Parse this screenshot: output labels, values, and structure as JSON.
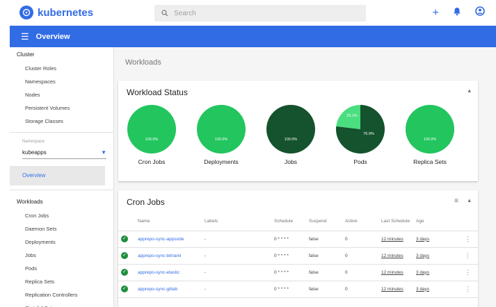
{
  "app": {
    "brand": "kubernetes"
  },
  "search": {
    "placeholder": "Search"
  },
  "header": {
    "title": "Overview"
  },
  "sidebar": {
    "cluster_label": "Cluster",
    "cluster_items": [
      "Cluster Roles",
      "Namespaces",
      "Nodes",
      "Persistent Volumes",
      "Storage Classes"
    ],
    "namespace_label": "Namespace",
    "namespace_value": "kubeapps",
    "overview_label": "Overview",
    "workloads_label": "Workloads",
    "workload_items": [
      "Cron Jobs",
      "Daemon Sets",
      "Deployments",
      "Jobs",
      "Pods",
      "Replica Sets",
      "Replication Controllers",
      "Stateful Sets"
    ]
  },
  "main": {
    "page_title": "Workloads",
    "status_card": {
      "title": "Workload Status",
      "charts": [
        {
          "label": "Cron Jobs",
          "value_text": "100.0%",
          "fraction": 1.0,
          "color": "#22c55e"
        },
        {
          "label": "Deployments",
          "value_text": "100.0%",
          "fraction": 1.0,
          "color": "#22c55e"
        },
        {
          "label": "Jobs",
          "value_text": "100.0%",
          "fraction": 1.0,
          "color": "#14532d"
        },
        {
          "label": "Pods",
          "value_text": "76.9%",
          "fraction": 0.769,
          "color": "#14532d",
          "other_text": "23.1%",
          "other_color": "#4ade80"
        },
        {
          "label": "Replica Sets",
          "value_text": "100.0%",
          "fraction": 1.0,
          "color": "#22c55e"
        }
      ]
    },
    "cron_card": {
      "title": "Cron Jobs",
      "columns": [
        "Name",
        "Labels",
        "Schedule",
        "Suspend",
        "Active",
        "Last Schedule",
        "Age"
      ],
      "rows": [
        {
          "name": "apprepo-sync-appsode",
          "labels": "-",
          "schedule": "0 * * * *",
          "suspend": "false",
          "active": "0",
          "last": "12 minutes",
          "age": "3 days"
        },
        {
          "name": "apprepo-sync-bitnami",
          "labels": "-",
          "schedule": "0 * * * *",
          "suspend": "false",
          "active": "0",
          "last": "12 minutes",
          "age": "3 days"
        },
        {
          "name": "apprepo-sync-elastic",
          "labels": "-",
          "schedule": "0 * * * *",
          "suspend": "false",
          "active": "0",
          "last": "12 minutes",
          "age": "3 days"
        },
        {
          "name": "apprepo-sync-gitlab",
          "labels": "-",
          "schedule": "0 * * * *",
          "suspend": "false",
          "active": "0",
          "last": "12 minutes",
          "age": "3 days"
        }
      ]
    }
  },
  "colors": {
    "primary": "#326ce5",
    "ok": "#1e8e3e"
  }
}
